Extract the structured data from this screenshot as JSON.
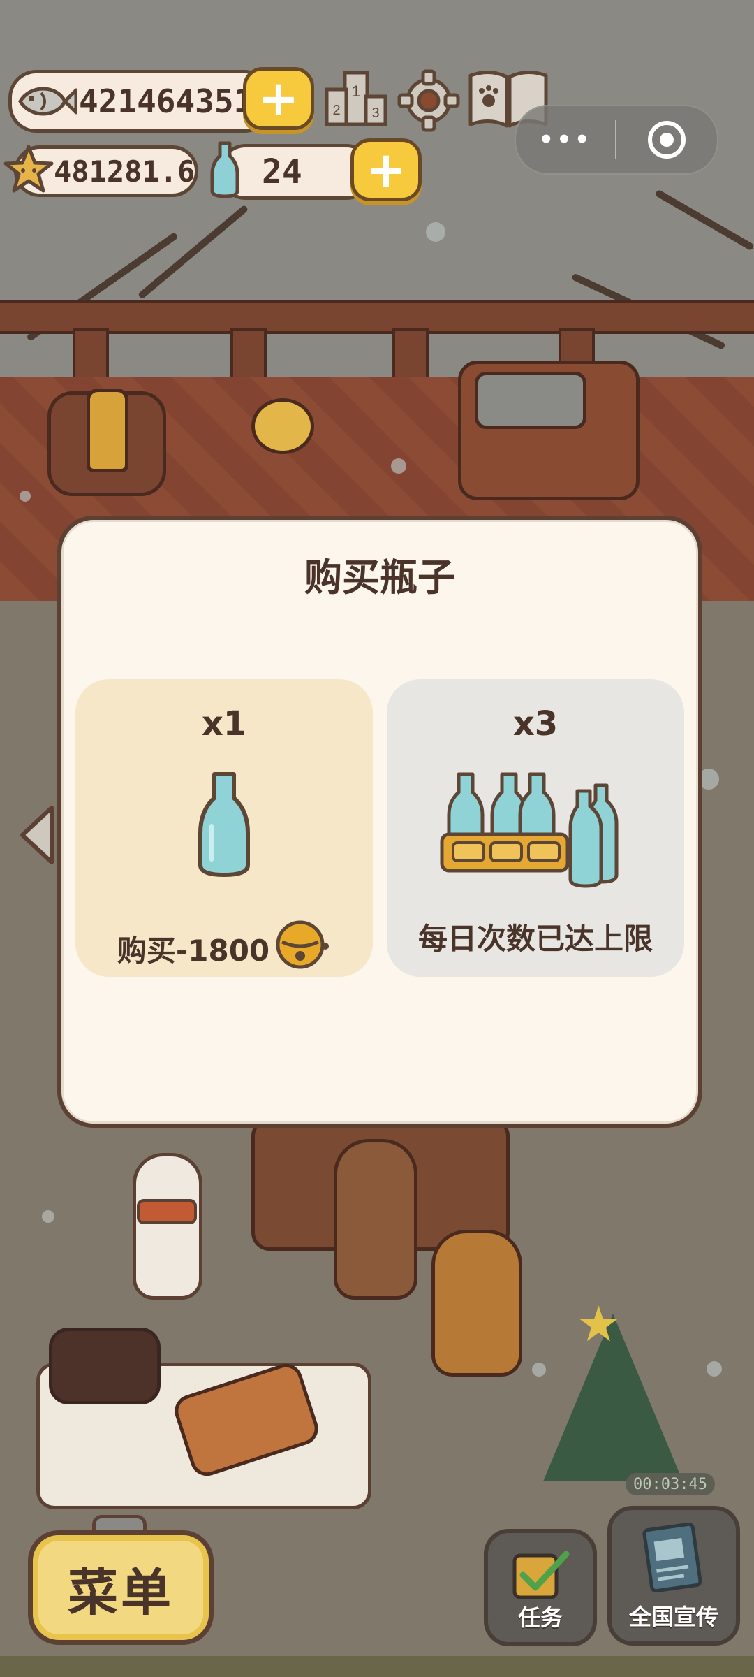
{
  "hud": {
    "fish_count": "421464351",
    "star_count": "481281.6",
    "bottle_count": "24",
    "icons": [
      "fish-icon",
      "star-icon",
      "bottle-icon",
      "ranking-icon",
      "settings-gear-icon",
      "paw-book-icon"
    ]
  },
  "capsule": {
    "more_label": "•••",
    "icons": [
      "more-dots-icon",
      "close-target-icon"
    ]
  },
  "modal": {
    "title": "购买瓶子",
    "options": [
      {
        "quantity": "x1",
        "label": "购买-1800",
        "icon": "gold-bell-icon",
        "state": "available"
      },
      {
        "quantity": "x3",
        "label": "每日次数已达上限",
        "state": "disabled"
      }
    ]
  },
  "bottom": {
    "menu_label": "菜单",
    "task_label": "任务",
    "promo_label": "全国宣传",
    "timer": "00:03:45"
  },
  "colors": {
    "accent_yellow": "#f7c93c",
    "outline_brown": "#5b4033",
    "modal_bg": "#fcf6ec",
    "card_available": "#f6e7c8",
    "card_disabled": "#e7e6e3"
  }
}
